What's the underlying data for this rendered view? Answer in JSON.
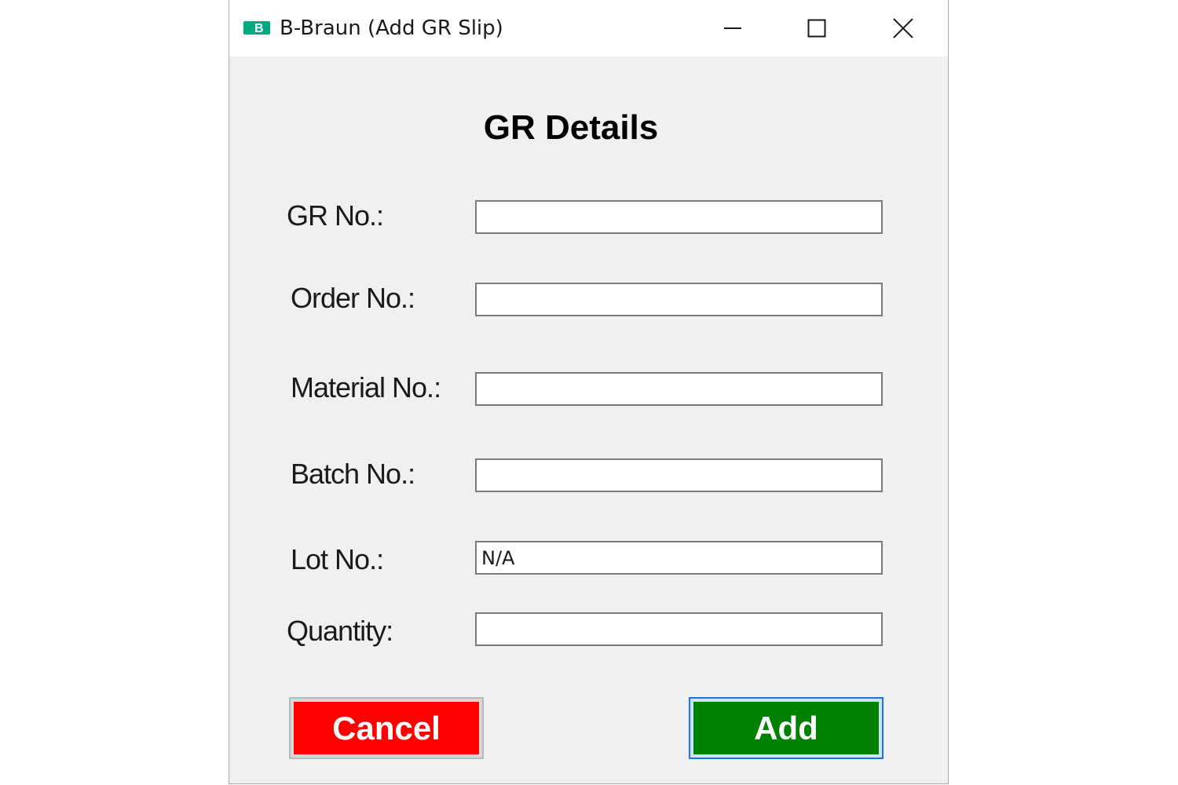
{
  "window": {
    "title": "B-Braun (Add GR Slip)",
    "icon": "b-braun-logo-icon",
    "controls": {
      "minimize_icon": "minimize-icon",
      "maximize_icon": "maximize-icon",
      "close_icon": "close-icon"
    }
  },
  "form": {
    "heading": "GR Details",
    "fields": [
      {
        "label": "GR No.:",
        "value": "",
        "placeholder": ""
      },
      {
        "label": "Order No.:",
        "value": "",
        "placeholder": ""
      },
      {
        "label": "Material No.:",
        "value": "",
        "placeholder": ""
      },
      {
        "label": "Batch No.:",
        "value": "",
        "placeholder": ""
      },
      {
        "label": "Lot No.:",
        "value": "N/A",
        "placeholder": ""
      },
      {
        "label": "Quantity:",
        "value": "",
        "placeholder": ""
      }
    ]
  },
  "actions": {
    "cancel_label": "Cancel",
    "add_label": "Add"
  },
  "colors": {
    "cancel_bg": "#ff0000",
    "add_bg": "#008000",
    "add_focus_border": "#1a73e8",
    "brand_green": "#00a97f"
  }
}
